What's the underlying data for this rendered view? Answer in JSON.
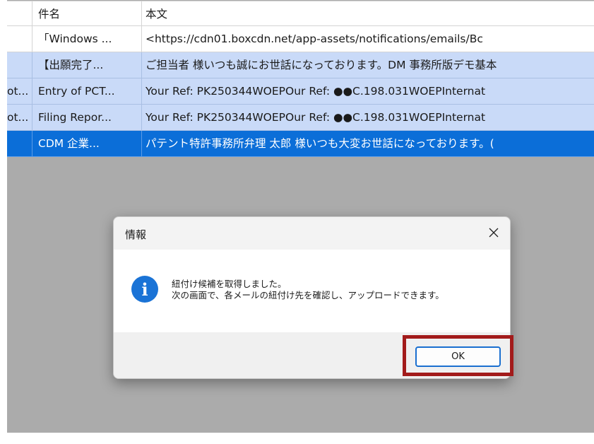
{
  "grid": {
    "headers": [
      "",
      "件名",
      "本文"
    ],
    "rows": [
      {
        "style": "white",
        "cells": [
          "",
          "「Windows ...",
          "<https://cdn01.boxcdn.net/app-assets/notifications/emails/Bc"
        ]
      },
      {
        "style": "light",
        "cells": [
          "",
          "【出願完了...",
          "ご担当者 様いつも誠にお世話になっております。DM 事務所版デモ基本"
        ]
      },
      {
        "style": "light",
        "cells": [
          "ot...",
          "Entry of PCT...",
          "Your Ref: PK250344WOEPOur Ref:  ●●C.198.031WOEPInternat"
        ]
      },
      {
        "style": "light",
        "cells": [
          "ot...",
          "Filing Repor...",
          "Your Ref: PK250344WOEPOur Ref:  ●●C.198.031WOEPInternat"
        ]
      },
      {
        "style": "sel",
        "cells": [
          "",
          "CDM 企業...",
          "パテント特許事務所弁理 太郎 様いつも大変お世話になっております。("
        ]
      }
    ]
  },
  "dialog": {
    "title": "情報",
    "close_icon": "close-icon",
    "info_icon": "info-icon",
    "info_glyph": "i",
    "message_line1": "紐付け候補を取得しました。",
    "message_line2": "次の画面で、各メールの紐付け先を確認し、アップロードできます。",
    "ok_label": "OK"
  },
  "colors": {
    "selected_row": "#0b6ed8",
    "light_row": "#c9daf8",
    "overlay": "#ababab",
    "info_icon": "#1a73d6",
    "highlight": "#a21b1b"
  }
}
